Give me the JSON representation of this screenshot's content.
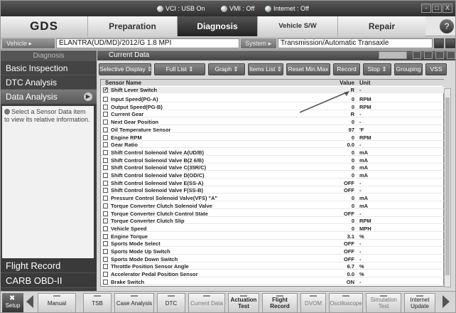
{
  "status": {
    "vci": "VCI : USB On",
    "vmi": "VMI : Off",
    "internet": "Internet : Off"
  },
  "window_buttons": [
    "-",
    "□",
    "X"
  ],
  "logo": "GDS",
  "nav": {
    "tabs": [
      "Preparation",
      "Diagnosis",
      "Vehicle S/W Management",
      "Repair"
    ],
    "active": "Diagnosis",
    "help_icon": "?"
  },
  "vehicle_bar": {
    "vehicle_label": "Vehicle",
    "vehicle_value": "ELANTRA(UD/MD)/2012/G 1.8 MPI",
    "system_label": "System",
    "system_value": "Transmission/Automatic Transaxle"
  },
  "sidebar": {
    "title": "Diagnosis",
    "items": [
      "Basic Inspection",
      "DTC Analysis",
      "Data Analysis"
    ],
    "active": "Data Analysis",
    "info": "Select a Sensor Data item to view its relative information.",
    "bottom_items": [
      "Flight Record",
      "CARB OBD-II"
    ]
  },
  "panel": {
    "title": "Current Data",
    "toolbar": [
      "Selective Display",
      "Full List",
      "Graph",
      "Items List",
      "Reset Min.Max",
      "Record",
      "Stop",
      "Grouping",
      "VSS"
    ],
    "columns": {
      "name": "Sensor Name",
      "value": "Value",
      "unit": "Unit"
    },
    "fixed_row": {
      "name": "Shift Lever Switch",
      "value": "R",
      "unit": "-"
    },
    "rows": [
      {
        "name": "Input Speed(PG-A)",
        "value": "0",
        "unit": "RPM"
      },
      {
        "name": "Output Speed(PG-B)",
        "value": "0",
        "unit": "RPM"
      },
      {
        "name": "Current Gear",
        "value": "R",
        "unit": "-"
      },
      {
        "name": "Next Gear Position",
        "value": "0",
        "unit": "-"
      },
      {
        "name": "Oil Temperature Sensor",
        "value": "97",
        "unit": "'F"
      },
      {
        "name": "Engine RPM",
        "value": "0",
        "unit": "RPM"
      },
      {
        "name": "Gear Ratio",
        "value": "0.0",
        "unit": "-"
      },
      {
        "name": "Shift Control Solenoid Valve A(UD/B)",
        "value": "0",
        "unit": "mA"
      },
      {
        "name": "Shift Control Solenoid Valve B(2 6/B)",
        "value": "0",
        "unit": "mA"
      },
      {
        "name": "Shift Control Solenoid Valve C(35R/C)",
        "value": "0",
        "unit": "mA"
      },
      {
        "name": "Shift Control Solenoid Valve D(OD/C)",
        "value": "0",
        "unit": "mA"
      },
      {
        "name": "Shift Control Solenoid Valve E(SS-A)",
        "value": "OFF",
        "unit": "-"
      },
      {
        "name": "Shift Control Solenoid Valve F(SS-B)",
        "value": "OFF",
        "unit": "-"
      },
      {
        "name": "Pressure Control Solenoid Valve(VFS) \"A\"",
        "value": "0",
        "unit": "mA"
      },
      {
        "name": "Torque Converter Clutch Solenoid Valve",
        "value": "0",
        "unit": "mA"
      },
      {
        "name": "Torque Converter Clutch Control State",
        "value": "OFF",
        "unit": "-"
      },
      {
        "name": "Torque Converter Clutch Slip",
        "value": "0",
        "unit": "RPM"
      },
      {
        "name": "Vehicle Speed",
        "value": "0",
        "unit": "MPH"
      },
      {
        "name": "Engine Torque",
        "value": "3.1",
        "unit": "%"
      },
      {
        "name": "Sports Mode Select",
        "value": "OFF",
        "unit": "-"
      },
      {
        "name": "Sports Mode Up Switch",
        "value": "OFF",
        "unit": "-"
      },
      {
        "name": "Sports Mode Down Switch",
        "value": "OFF",
        "unit": "-"
      },
      {
        "name": "Throttle Position Sensor Angle",
        "value": "6.7",
        "unit": "%"
      },
      {
        "name": "Accelerator Pedal Position Sensor",
        "value": "0.0",
        "unit": "%"
      },
      {
        "name": "Brake Switch",
        "value": "ON",
        "unit": "-"
      }
    ]
  },
  "bottom_bar": {
    "setup": "Setup",
    "buttons": [
      "Manual",
      "TSB",
      "Case Analysis",
      "DTC",
      "Current Data",
      "Actuation Test",
      "Flight Record",
      "DVOM",
      "Oscilloscope",
      "Simulation Test",
      "Internet Update"
    ]
  }
}
